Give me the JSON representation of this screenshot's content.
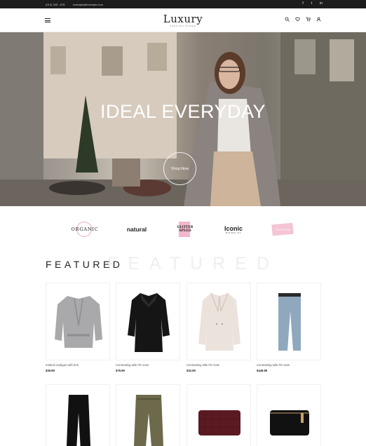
{
  "topbar": {
    "phone": "(012) 345 - 678",
    "email": "example@example.com",
    "socials": [
      "f",
      "t",
      "in"
    ]
  },
  "header": {
    "logo": "Luxury",
    "logo_sub": "FASHION STORE"
  },
  "hero": {
    "title": "IDEAL EVERYDAY",
    "button": "Shop Now"
  },
  "brands": {
    "organic": "ORGANIC",
    "natural": "natural",
    "glitter": "GLITTER SPEED",
    "iconic": "Iconic",
    "iconic_sub": "MINIMALIST",
    "fashion": "FASHION"
  },
  "featured": {
    "title": "FEATURED",
    "ghost": "FEATURED"
  },
  "products": [
    {
      "name": "Knitted cardigan with belt",
      "price": "$39.99"
    },
    {
      "name": "Contrasting tulle Pin-nots",
      "price": "$79.99"
    },
    {
      "name": "Contrasting tulle Pin-nots",
      "price": "$32.99"
    },
    {
      "name": "Contrasting tulle Pin-nots",
      "price": "$449.99"
    },
    {
      "name": "",
      "price": ""
    },
    {
      "name": "",
      "price": ""
    },
    {
      "name": "",
      "price": ""
    },
    {
      "name": "",
      "price": ""
    }
  ],
  "colors": {
    "topbar": "#1c1c1c",
    "accent_pink": "#f4b6cd"
  },
  "icons": [
    "menu-icon",
    "search-icon",
    "heart-icon",
    "cart-icon",
    "user-icon",
    "facebook-icon",
    "twitter-icon",
    "instagram-icon"
  ]
}
